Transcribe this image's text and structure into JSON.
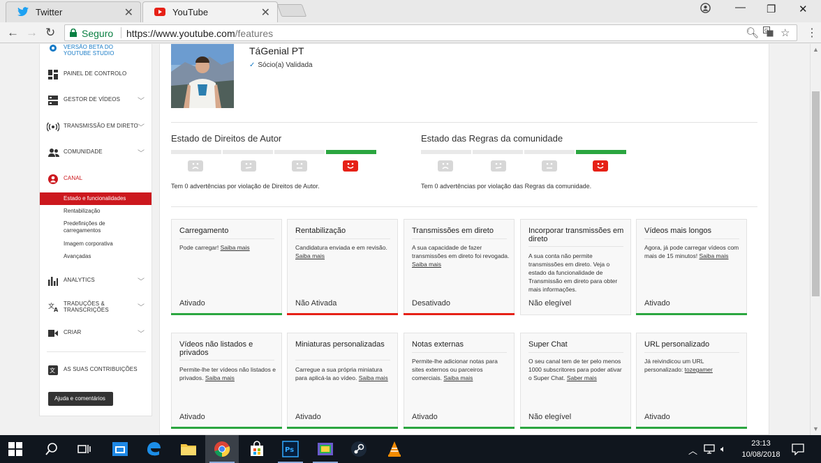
{
  "browser": {
    "tabs": [
      {
        "title": "Twitter"
      },
      {
        "title": "YouTube"
      }
    ],
    "secure_label": "Seguro",
    "url_host": "https://www.youtube.com",
    "url_path": "/features"
  },
  "sidebar": {
    "top_partial": "VERSÃO BETA DO YOUTUBE STUDIO",
    "items": [
      {
        "label": "PAINEL DE CONTROLO",
        "icon": "dashboard-icon"
      },
      {
        "label": "GESTOR DE VÍDEOS",
        "icon": "video-manager-icon"
      },
      {
        "label": "TRANSMISSÃO EM DIRETO",
        "icon": "live-icon"
      },
      {
        "label": "COMUNIDADE",
        "icon": "community-icon"
      },
      {
        "label": "CANAL",
        "icon": "channel-icon"
      }
    ],
    "sub_items": [
      {
        "label": "Estado e funcionalidades"
      },
      {
        "label": "Rentabilização"
      },
      {
        "label": "Predefinições de carregamentos"
      },
      {
        "label": "Imagem corporativa"
      },
      {
        "label": "Avançadas"
      }
    ],
    "items2": [
      {
        "label": "ANALYTICS",
        "icon": "analytics-icon"
      },
      {
        "label": "TRADUÇÕES & TRANSCRIÇÕES",
        "icon": "translate-icon"
      },
      {
        "label": "CRIAR",
        "icon": "create-icon"
      }
    ],
    "contributions": "AS SUAS CONTRIBUIÇÕES",
    "help_button": "Ajuda e comentários",
    "accent_color": "#cc181e"
  },
  "channel": {
    "name": "TáGenial PT",
    "partner_status": "Sócio(a) Validada"
  },
  "copyright": {
    "title": "Estado de Direitos de Autor",
    "text": "Tem 0 advertências por violação de Direitos de Autor."
  },
  "community": {
    "title": "Estado das Regras da comunidade",
    "text": "Tem 0 advertências por violação das Regras da comunidade."
  },
  "features": [
    {
      "title": "Carregamento",
      "desc": "Pode carregar!",
      "link": "Saiba mais",
      "status": "Ativado",
      "state": "green"
    },
    {
      "title": "Rentabilização",
      "desc": "Candidatura enviada e em revisão.",
      "link": "Saiba mais",
      "status": "Não Ativada",
      "state": "red"
    },
    {
      "title": "Transmissões em direto",
      "desc": "A sua capacidade de fazer transmissões em direto foi revogada.",
      "link": "Saiba mais",
      "status": "Desativado",
      "state": "red"
    },
    {
      "title": "Incorporar transmissões em direto",
      "desc": "A sua conta não permite transmissões em direto. Veja o estado da funcionalidade de Transmissão em direto para obter mais informações.",
      "link": "",
      "status": "Não elegível",
      "state": "none"
    },
    {
      "title": "Vídeos mais longos",
      "desc": "Agora, já pode carregar vídeos com mais de 15 minutos!",
      "link": "Saiba mais",
      "status": "Ativado",
      "state": "green"
    },
    {
      "title": "Vídeos não listados e privados",
      "desc": "Permite-lhe ter vídeos não listados e privados.",
      "link": "Saiba mais",
      "status": "Ativado",
      "state": "green"
    },
    {
      "title": "Miniaturas personalizadas",
      "desc": "Carregue a sua própria miniatura para aplicá-la ao vídeo.",
      "link": "Saiba mais",
      "status": "Ativado",
      "state": "green"
    },
    {
      "title": "Notas externas",
      "desc": "Permite-lhe adicionar notas para sites externos ou parceiros comerciais.",
      "link": "Saiba mais",
      "status": "Ativado",
      "state": "green"
    },
    {
      "title": "Super Chat",
      "desc": "O seu canal tem de ter pelo menos 1000 subscritores para poder ativar o Super Chat.",
      "link": "Saber mais",
      "status": "Não elegível",
      "state": "green"
    },
    {
      "title": "URL personalizado",
      "desc": "Já reivindicou um URL personalizado:",
      "link": "tozegamer",
      "status": "Ativado",
      "state": "green"
    }
  ],
  "taskbar": {
    "time": "23:13",
    "date": "10/08/2018"
  }
}
